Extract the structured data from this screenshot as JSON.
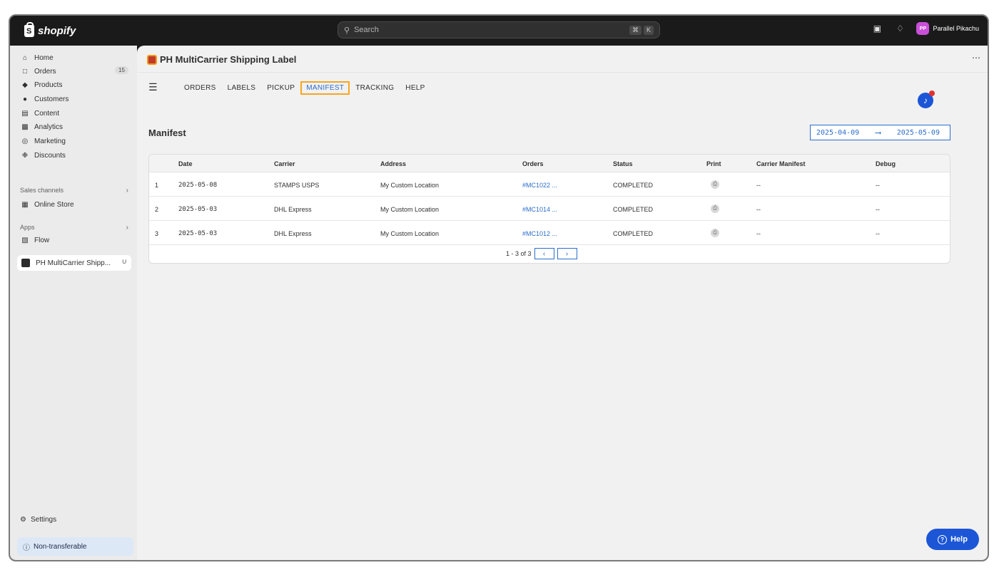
{
  "topbar": {
    "brand": "shopify",
    "search_placeholder": "Search",
    "shortcut_keys": [
      "⌘",
      "K"
    ],
    "user_initials": "PP",
    "user_name": "Parallel Pikachu"
  },
  "sidebar": {
    "items": [
      {
        "label": "Home",
        "icon": "home-icon"
      },
      {
        "label": "Orders",
        "icon": "orders-icon",
        "badge": "15"
      },
      {
        "label": "Products",
        "icon": "products-icon"
      },
      {
        "label": "Customers",
        "icon": "customers-icon"
      },
      {
        "label": "Content",
        "icon": "content-icon"
      },
      {
        "label": "Analytics",
        "icon": "analytics-icon"
      },
      {
        "label": "Marketing",
        "icon": "marketing-icon"
      },
      {
        "label": "Discounts",
        "icon": "discounts-icon"
      }
    ],
    "sales_channels_label": "Sales channels",
    "online_store": "Online Store",
    "apps_label": "Apps",
    "flow": "Flow",
    "pinned_app": "PH MultiCarrier Shipp...",
    "settings": "Settings",
    "non_transferable": "Non-transferable"
  },
  "app": {
    "title": "PH MultiCarrier Shipping Label",
    "tabs": [
      "ORDERS",
      "LABELS",
      "PICKUP",
      "MANIFEST",
      "TRACKING",
      "HELP"
    ],
    "active_tab": "MANIFEST",
    "page_title": "Manifest",
    "date_start": "2025-04-09",
    "date_end": "2025-05-09"
  },
  "table": {
    "headers": [
      "Date",
      "Carrier",
      "Address",
      "Orders",
      "Status",
      "Print",
      "Carrier Manifest",
      "Debug"
    ],
    "rows": [
      {
        "index": "1",
        "date": "2025-05-08",
        "carrier": "STAMPS USPS",
        "address": "My Custom Location",
        "orders": "#MC1022 ...",
        "status": "COMPLETED",
        "carrier_manifest": "--",
        "debug": "--"
      },
      {
        "index": "2",
        "date": "2025-05-03",
        "carrier": "DHL Express",
        "address": "My Custom Location",
        "orders": "#MC1014 ...",
        "status": "COMPLETED",
        "carrier_manifest": "--",
        "debug": "--"
      },
      {
        "index": "3",
        "date": "2025-05-03",
        "carrier": "DHL Express",
        "address": "My Custom Location",
        "orders": "#MC1012 ...",
        "status": "COMPLETED",
        "carrier_manifest": "--",
        "debug": "--"
      }
    ],
    "pagination": "1 - 3 of 3"
  },
  "help_button": "Help",
  "colors": {
    "accent": "#2c6ecb",
    "highlight": "#f5a623",
    "primary_button": "#1c56d6"
  }
}
